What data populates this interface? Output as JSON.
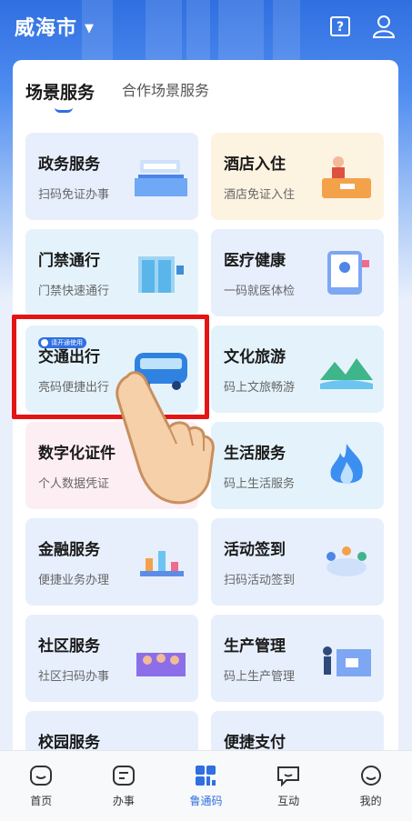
{
  "header": {
    "city": "威海市"
  },
  "tabs": [
    {
      "label": "场景服务",
      "active": true
    },
    {
      "label": "合作场景服务",
      "active": false
    }
  ],
  "highlight_badge": "请开通使用",
  "cards": [
    {
      "title": "政务服务",
      "subtitle": "扫码免证办事",
      "icon": "service-hall-illustration"
    },
    {
      "title": "酒店入住",
      "subtitle": "酒店免证入住",
      "icon": "hotel-reception-illustration"
    },
    {
      "title": "门禁通行",
      "subtitle": "门禁快速通行",
      "icon": "access-gate-illustration"
    },
    {
      "title": "医疗健康",
      "subtitle": "一码就医体检",
      "icon": "medical-illustration"
    },
    {
      "title": "交通出行",
      "subtitle": "亮码便捷出行",
      "icon": "bus-illustration"
    },
    {
      "title": "文化旅游",
      "subtitle": "码上文旅畅游",
      "icon": "mountain-illustration"
    },
    {
      "title": "数字化证件",
      "subtitle": "个人数据凭证",
      "icon": "id-card-illustration"
    },
    {
      "title": "生活服务",
      "subtitle": "码上生活服务",
      "icon": "flame-illustration"
    },
    {
      "title": "金融服务",
      "subtitle": "便捷业务办理",
      "icon": "finance-illustration"
    },
    {
      "title": "活动签到",
      "subtitle": "扫码活动签到",
      "icon": "meeting-illustration"
    },
    {
      "title": "社区服务",
      "subtitle": "社区扫码办事",
      "icon": "community-illustration"
    },
    {
      "title": "生产管理",
      "subtitle": "码上生产管理",
      "icon": "production-illustration"
    },
    {
      "title": "校园服务",
      "subtitle": "",
      "icon": "campus-illustration"
    },
    {
      "title": "便捷支付",
      "subtitle": "",
      "icon": "payment-illustration"
    }
  ],
  "bottom_nav": [
    {
      "label": "首页",
      "icon": "home-icon",
      "active": false
    },
    {
      "label": "办事",
      "icon": "tasks-icon",
      "active": false
    },
    {
      "label": "鲁通码",
      "icon": "code-grid-icon",
      "active": true
    },
    {
      "label": "互动",
      "icon": "chat-icon",
      "active": false
    },
    {
      "label": "我的",
      "icon": "profile-icon",
      "active": false
    }
  ],
  "colors": {
    "brand": "#2f6fe0",
    "highlight": "#e51414"
  }
}
